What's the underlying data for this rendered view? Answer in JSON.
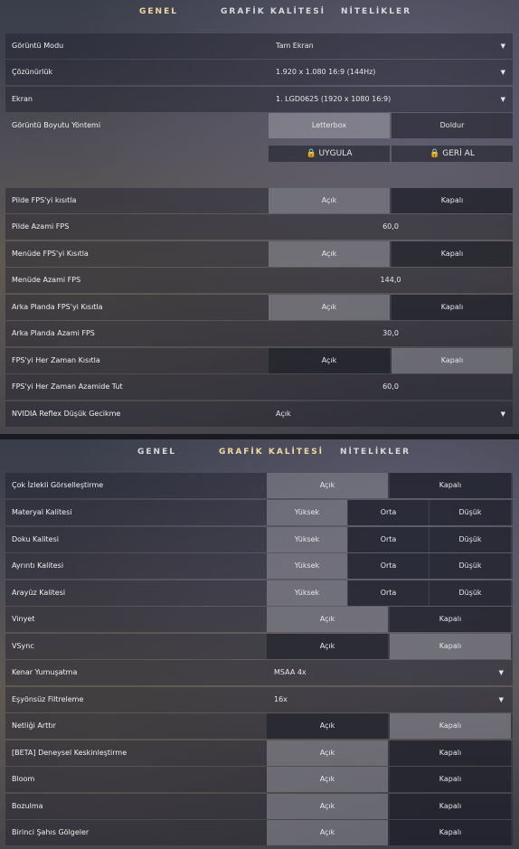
{
  "tabs": [
    "GENEL",
    "GRAFİK KALİTESİ",
    "NİTELİKLER"
  ],
  "general": {
    "display_mode": {
      "label": "Görüntü Modu",
      "value": "Tam Ekran"
    },
    "resolution": {
      "label": "Çözünürlük",
      "value": "1.920 x 1.080 16:9 (144Hz)"
    },
    "monitor": {
      "label": "Ekran",
      "value": "1. LGD0625 (1920 x  1080 16:9)"
    },
    "aspect_method": {
      "label": "Görüntü Boyutu Yöntemi",
      "opt1": "Letterbox",
      "opt2": "Doldur"
    },
    "apply": "UYGULA",
    "revert": "GERİ AL",
    "limit_fps_game": {
      "label": "Pilde FPS'yi kısıtla",
      "on": "Açık",
      "off": "Kapalı"
    },
    "max_fps_game": {
      "label": "Pilde Azami FPS",
      "value": "60,0"
    },
    "limit_fps_menu": {
      "label": "Menüde FPS'yi Kısıtla",
      "on": "Açık",
      "off": "Kapalı"
    },
    "max_fps_menu": {
      "label": "Menüde Azami FPS",
      "value": "144,0"
    },
    "limit_fps_bg": {
      "label": "Arka Planda FPS'yi Kısıtla",
      "on": "Açık",
      "off": "Kapalı"
    },
    "max_fps_bg": {
      "label": "Arka Planda Azami FPS",
      "value": "30,0"
    },
    "limit_fps_always": {
      "label": "FPS'yi Her Zaman Kısıtla",
      "on": "Açık",
      "off": "Kapalı"
    },
    "max_fps_always": {
      "label": "FPS'yi Her Zaman Azamide Tut",
      "value": "60,0"
    },
    "reflex": {
      "label": "NVIDIA Reflex Düşük Gecikme",
      "value": "Açık"
    }
  },
  "graphics": {
    "multithreaded": {
      "label": "Çok İzlekli Görselleştirme",
      "on": "Açık",
      "off": "Kapalı"
    },
    "material": {
      "label": "Materyal Kalitesi",
      "high": "Yüksek",
      "mid": "Orta",
      "low": "Düşük"
    },
    "texture": {
      "label": "Doku Kalitesi",
      "high": "Yüksek",
      "mid": "Orta",
      "low": "Düşük"
    },
    "detail": {
      "label": "Ayrıntı Kalitesi",
      "high": "Yüksek",
      "mid": "Orta",
      "low": "Düşük"
    },
    "ui": {
      "label": "Arayüz Kalitesi",
      "high": "Yüksek",
      "mid": "Orta",
      "low": "Düşük"
    },
    "vignette": {
      "label": "Vinyet",
      "on": "Açık",
      "off": "Kapalı"
    },
    "vsync": {
      "label": "VSync",
      "on": "Açık",
      "off": "Kapalı"
    },
    "aa": {
      "label": "Kenar Yumuşatma",
      "value": "MSAA 4x"
    },
    "af": {
      "label": "Eşyönsüz Filtreleme",
      "value": "16x"
    },
    "clarity": {
      "label": "Netliği Arttır",
      "on": "Açık",
      "off": "Kapalı"
    },
    "sharpen": {
      "label": "[BETA] Deneysel Keskinleştirme",
      "on": "Açık",
      "off": "Kapalı"
    },
    "bloom": {
      "label": "Bloom",
      "on": "Açık",
      "off": "Kapalı"
    },
    "distortion": {
      "label": "Bozulma",
      "on": "Açık",
      "off": "Kapalı"
    },
    "fp_shadows": {
      "label": "Birinci Şahıs Gölgeler",
      "on": "Açık",
      "off": "Kapalı"
    }
  }
}
